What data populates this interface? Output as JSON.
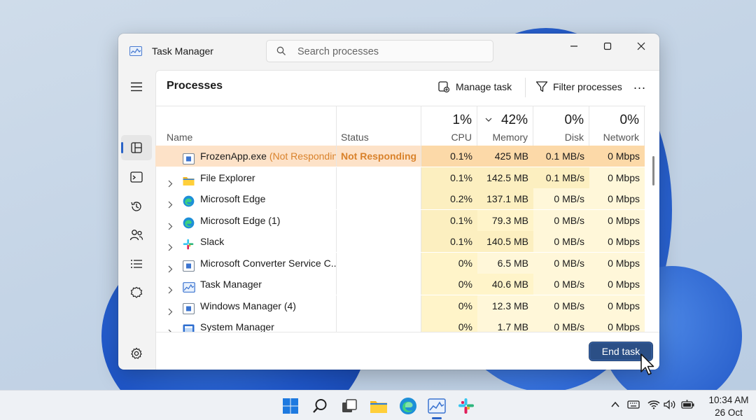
{
  "window": {
    "title": "Task Manager",
    "search_placeholder": "Search processes"
  },
  "sidebar": {
    "items": [
      {
        "name": "hamburger-icon"
      },
      {
        "name": "processes-icon",
        "active": true
      },
      {
        "name": "performance-icon"
      },
      {
        "name": "app-history-icon"
      },
      {
        "name": "users-icon"
      },
      {
        "name": "details-icon"
      },
      {
        "name": "services-icon"
      }
    ],
    "settings_icon": "gear-icon"
  },
  "toolbar": {
    "page_title": "Processes",
    "run_task_label": "Manage task",
    "filter_label": "Filter processes",
    "more_label": "..."
  },
  "table": {
    "headers": {
      "name": "Name",
      "status": "Status",
      "cpu_pct": "1%",
      "cpu": "CPU",
      "memory_pct": "42%",
      "memory": "Memory",
      "disk_pct": "0%",
      "disk": "Disk",
      "network_pct": "0%",
      "network": "Network"
    },
    "rows": [
      {
        "name": "FrozenApp.exe",
        "suffix": " (Not Responding)",
        "status": "Not Responding",
        "cpu": "0.1%",
        "memory": "425 MB",
        "disk": "0.1 MB/s",
        "network": "0 Mbps",
        "icon": "generic-app-icon"
      },
      {
        "name": "File Explorer",
        "suffix": "",
        "status": "",
        "cpu": "0.1%",
        "memory": "142.5 MB",
        "disk": "0.1 MB/s",
        "network": "0 Mbps",
        "icon": "folder-icon"
      },
      {
        "name": "Microsoft Edge",
        "suffix": "",
        "status": "",
        "cpu": "0.2%",
        "memory": "137.1 MB",
        "disk": "0 MB/s",
        "network": "0 Mbps",
        "icon": "edge-icon"
      },
      {
        "name": "Microsoft Edge (1)",
        "suffix": "",
        "status": "",
        "cpu": "0.1%",
        "memory": "79.3 MB",
        "disk": "0 MB/s",
        "network": "0 Mbps",
        "icon": "edge-icon"
      },
      {
        "name": "Slack",
        "suffix": "",
        "status": "",
        "cpu": "0.1%",
        "memory": "140.5 MB",
        "disk": "0 MB/s",
        "network": "0 Mbps",
        "icon": "slack-icon"
      },
      {
        "name": "Microsoft Converter Service C...",
        "suffix": "",
        "status": "",
        "cpu": "0%",
        "memory": "6.5 MB",
        "disk": "0 MB/s",
        "network": "0 Mbps",
        "icon": "generic-app-icon"
      },
      {
        "name": "Task Manager",
        "suffix": "",
        "status": "",
        "cpu": "0%",
        "memory": "40.6 MB",
        "disk": "0 MB/s",
        "network": "0 Mbps",
        "icon": "task-manager-icon"
      },
      {
        "name": "Windows Manager (4)",
        "suffix": "",
        "status": "",
        "cpu": "0%",
        "memory": "12.3 MB",
        "disk": "0 MB/s",
        "network": "0 Mbps",
        "icon": "generic-app-icon"
      },
      {
        "name": "System Manager",
        "suffix": "",
        "status": "",
        "cpu": "0%",
        "memory": "1.7 MB",
        "disk": "0 MB/s",
        "network": "0 Mbps",
        "icon": "system-manager-icon"
      }
    ]
  },
  "footer": {
    "end_task_label": "End task"
  },
  "taskbar": {
    "time": "10:34 AM",
    "date": "26 Oct",
    "pinned": [
      "windows-start-icon",
      "search-icon",
      "task-view-icon",
      "file-explorer-icon",
      "edge-icon",
      "task-manager-icon",
      "slack-icon"
    ],
    "tray": [
      "chevron-up-icon",
      "keyboard-icon",
      "wifi-icon",
      "volume-icon",
      "battery-icon"
    ]
  },
  "colors": {
    "accent": "#2a63c7",
    "not_responding": "#d9822b",
    "end_task_bg": "#2b4f86",
    "highlight_row": "#fde2c8"
  }
}
